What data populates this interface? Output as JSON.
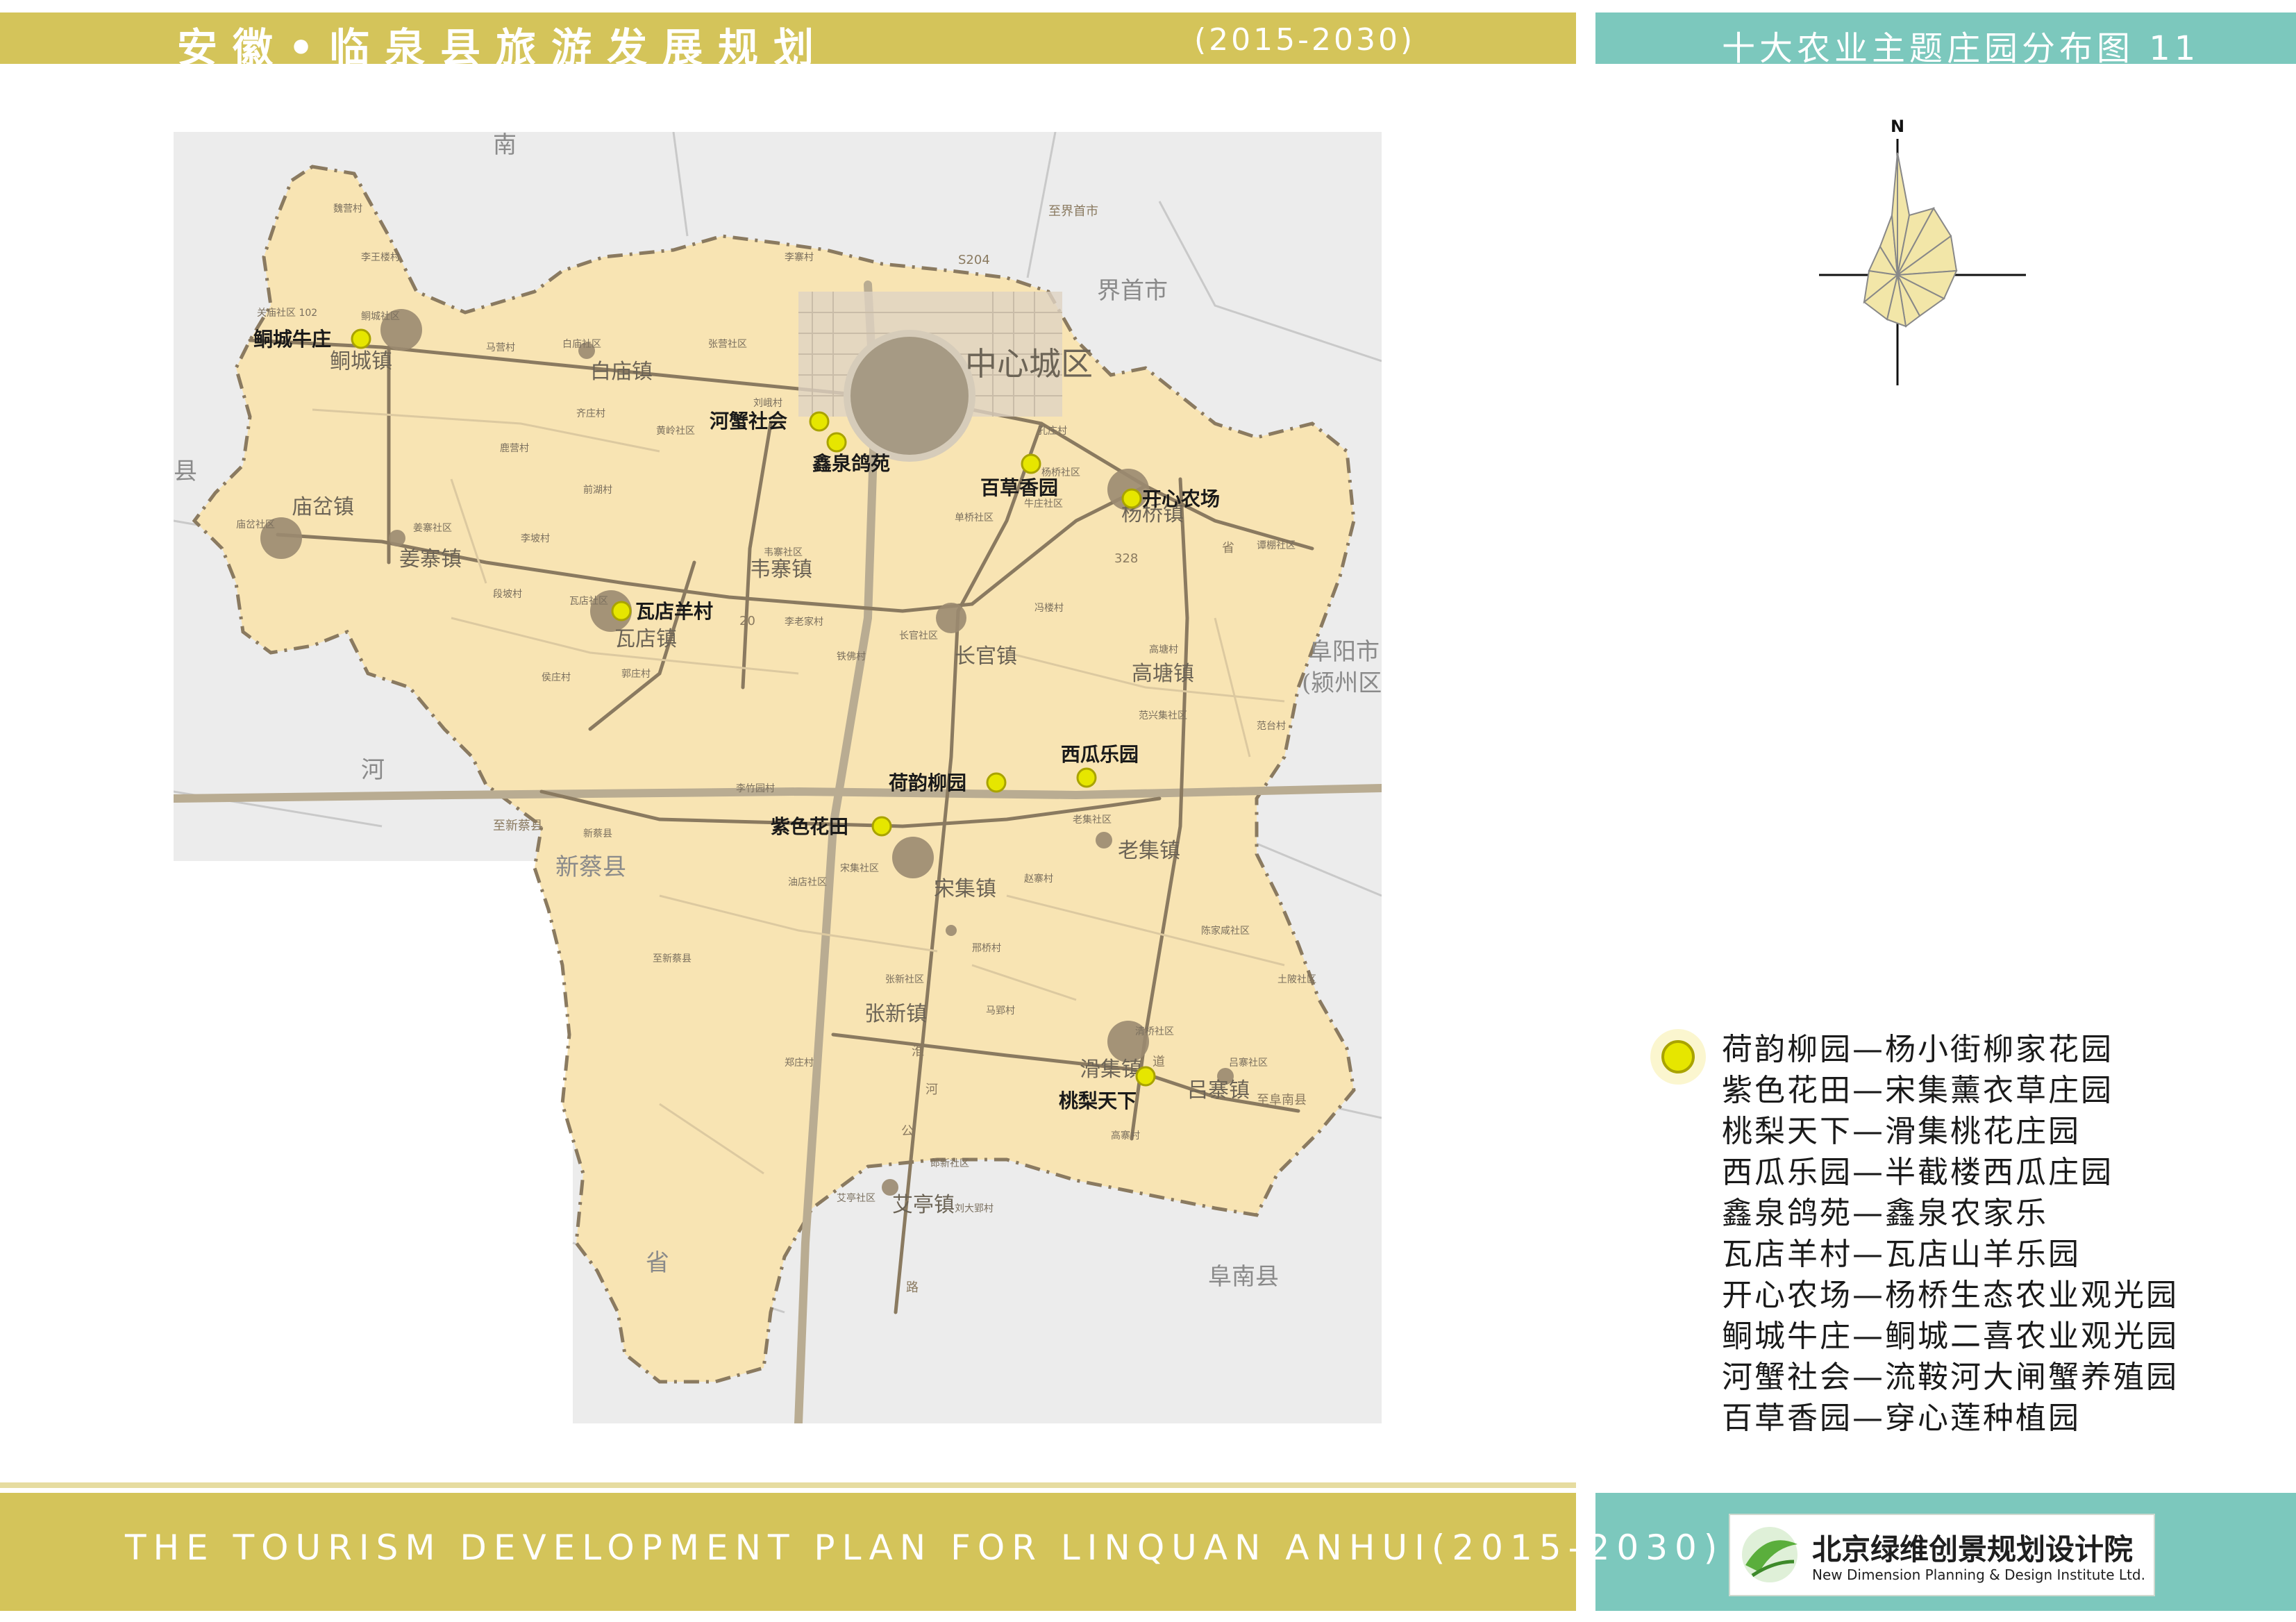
{
  "header": {
    "title_cn": "安徽•临泉县旅游发展规划",
    "title_year": "(2015-2030)",
    "map_title": "十大农业主题庄园分布图 11"
  },
  "footer": {
    "title_en": "THE TOURISM DEVELOPMENT PLAN FOR LINQUAN ANHUI(2015-2030)",
    "logo_cn": "北京绿维创景规划设计院",
    "logo_en": "New Dimension Planning & Design Institute Ltd."
  },
  "compass": {
    "north_label": "N"
  },
  "map": {
    "colors": {
      "county_fill": "#f8e4b3",
      "outside": "#ececec",
      "road": "#8a7a60",
      "highway": "#b9ac92",
      "town": "#9a8a70",
      "marker": "#e6e600"
    },
    "region_labels": {
      "nan": "南",
      "jieshou": "界首市",
      "zhongxin": "中心城区",
      "xian_w": "县",
      "fuyang": "阜阳市",
      "yingzhou": "(颍州区",
      "he": "河",
      "xincai_1": "新蔡县",
      "xincai_2": "新蔡县",
      "sheng": "省",
      "funan": "阜南县",
      "miaocha_label": "庙岔镇"
    },
    "towns": {
      "tongcheng": "鲖城镇",
      "baimiao": "白庙镇",
      "jiangzhai": "姜寨镇",
      "wadian": "瓦店镇",
      "weizhai": "韦寨镇",
      "changguan": "长官镇",
      "yangqiao": "杨桥镇",
      "gaotang": "高塘镇",
      "laoji": "老集镇",
      "songji": "宋集镇",
      "zhangxin": "张新镇",
      "huaji": "滑集镇",
      "lvzhai": "吕寨镇",
      "aiting": "艾亭镇"
    },
    "villages": [
      "魏营村",
      "李王楼村",
      "关庙社区 102",
      "鲖城社区",
      "白庙社区",
      "马营村",
      "张营社区",
      "李寨村",
      "刘峨村",
      "齐庄村",
      "黄岭社区",
      "鹿营村",
      "前湖村",
      "庙岔社区",
      "姜寨社区",
      "李坡村",
      "瓦店社区",
      "段坡村",
      "侯庄村",
      "郭庄村",
      "韦寨社区",
      "李老家村",
      "长官社区",
      "铁佛村",
      "高塘村",
      "杨桥社区",
      "孔庄村",
      "单桥社区",
      "牛庄社区",
      "谭棚社区",
      "冯楼村",
      "范兴集社区",
      "范台村",
      "老集社区",
      "赵寨村",
      "宋集社区",
      "张新社区",
      "马郢村",
      "清桥社区",
      "吕寨社区",
      "艾亭社区",
      "刘大郢村",
      "高寨村",
      "土陂社区",
      "陈家咸社区",
      "邢桥村",
      "李竹园村",
      "油店社区",
      "郑庄村",
      "郎新社区",
      "新蔡县",
      "至新蔡县"
    ],
    "road_labels": [
      "S204",
      "328",
      "20",
      "淮",
      "河",
      "公",
      "路",
      "省",
      "道",
      "至界首市",
      "至新蔡县",
      "至阜南县"
    ],
    "markers": [
      {
        "label": "鲖城牛庄"
      },
      {
        "label": "河蟹社会"
      },
      {
        "label": "鑫泉鸽苑"
      },
      {
        "label": "百草香园"
      },
      {
        "label": "开心农场"
      },
      {
        "label": "瓦店羊村"
      },
      {
        "label": "西瓜乐园"
      },
      {
        "label": "荷韵柳园"
      },
      {
        "label": "紫色花田"
      },
      {
        "label": "桃梨天下"
      }
    ]
  },
  "legend": {
    "items": [
      "荷韵柳园—杨小街柳家花园",
      "紫色花田—宋集薰衣草庄园",
      "桃梨天下—滑集桃花庄园",
      "西瓜乐园—半截楼西瓜庄园",
      "鑫泉鸽苑—鑫泉农家乐",
      "瓦店羊村—瓦店山羊乐园",
      "开心农场—杨桥生态农业观光园",
      "鲖城牛庄—鲖城二喜农业观光园",
      "河蟹社会—流鞍河大闸蟹养殖园",
      "百草香园—穿心莲种植园"
    ]
  }
}
